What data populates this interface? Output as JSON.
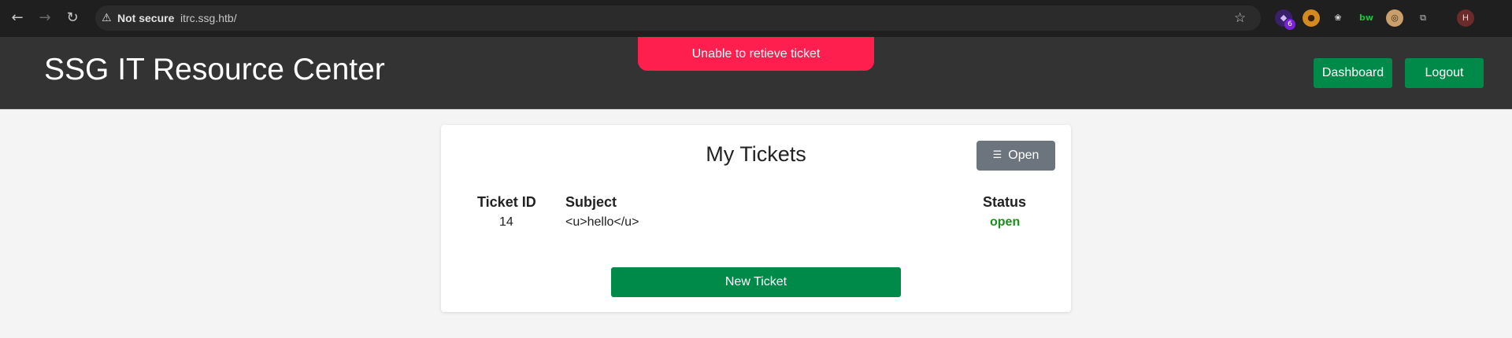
{
  "browser": {
    "security_label": "Not secure",
    "url": "itrc.ssg.htb/",
    "extension_badge": "6",
    "profile_initial": "H",
    "extensions": [
      "ext-purple-icon",
      "ext-orange-icon",
      "ext-cookie-icon",
      "ext-bw-icon",
      "ext-glasses-icon",
      "puzzle-icon"
    ]
  },
  "app": {
    "title": "SSG IT Resource Center",
    "nav": {
      "dashboard": "Dashboard",
      "logout": "Logout"
    },
    "toast": "Unable to retieve ticket",
    "accent_green": "#008a4a",
    "toast_color": "#ff1f4f"
  },
  "tickets": {
    "title": "My Tickets",
    "filter_label": "Open",
    "columns": {
      "id": "Ticket ID",
      "subject": "Subject",
      "status": "Status"
    },
    "rows": [
      {
        "id": "14",
        "subject": "<u>hello</u>",
        "status": "open"
      }
    ],
    "new_ticket_label": "New Ticket"
  }
}
